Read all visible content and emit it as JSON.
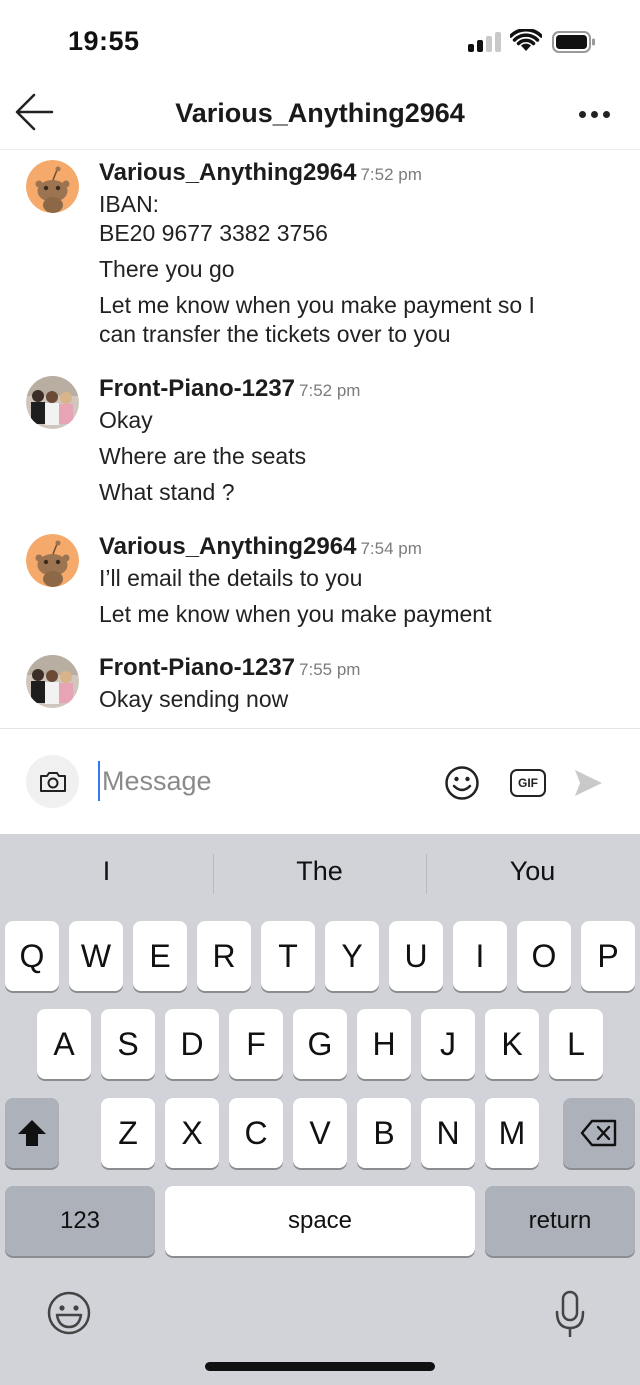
{
  "status_bar": {
    "time": "19:55"
  },
  "header": {
    "title": "Various_Anything2964",
    "back_icon": "arrow-left-icon",
    "more_icon": "more-horizontal-icon"
  },
  "messages": [
    {
      "user": "Various_Anything2964",
      "time": "7:52 pm",
      "avatar": "reddit-snoo-avatar",
      "lines": [
        "IBAN:",
        "BE20 9677 3382 3756",
        "There you go",
        "Let me know when you make payment so I",
        "can transfer the tickets over to you"
      ]
    },
    {
      "user": "Front-Piano-1237",
      "time": "7:52 pm",
      "avatar": "photo-avatar",
      "lines": [
        "Okay",
        "Where are the seats",
        "What stand ?"
      ]
    },
    {
      "user": "Various_Anything2964",
      "time": "7:54 pm",
      "avatar": "reddit-snoo-avatar",
      "lines": [
        "I’ll email the details to you",
        "Let me know when you make payment"
      ]
    },
    {
      "user": "Front-Piano-1237",
      "time": "7:55 pm",
      "avatar": "photo-avatar",
      "lines": [
        "Okay sending now"
      ]
    }
  ],
  "composer": {
    "placeholder": "Message",
    "gif_label": "GIF"
  },
  "keyboard": {
    "suggestions": [
      "I",
      "The",
      "You"
    ],
    "row1": [
      "Q",
      "W",
      "E",
      "R",
      "T",
      "Y",
      "U",
      "I",
      "O",
      "P"
    ],
    "row2": [
      "A",
      "S",
      "D",
      "F",
      "G",
      "H",
      "J",
      "K",
      "L"
    ],
    "row3": [
      "Z",
      "X",
      "C",
      "V",
      "B",
      "N",
      "M"
    ],
    "numbers_label": "123",
    "space_label": "space",
    "return_label": "return"
  },
  "colors": {
    "avatar_orange": "#f5a96b",
    "keyboard_bg": "#d1d3d9",
    "cursor_blue": "#3478f6"
  }
}
